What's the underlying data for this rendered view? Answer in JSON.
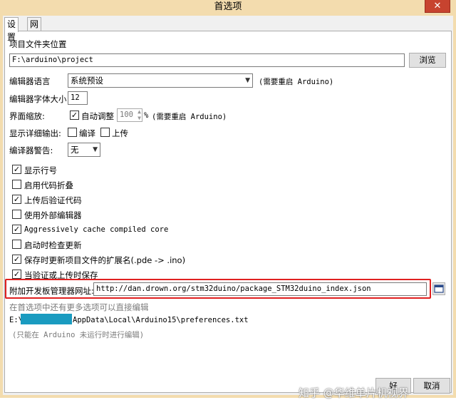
{
  "window": {
    "title": "首选项",
    "close": "✕"
  },
  "tabs": [
    "设置",
    "网络"
  ],
  "sketchbook": {
    "label": "项目文件夹位置",
    "path": "F:\\arduino\\project",
    "browse": "浏览"
  },
  "editor_language": {
    "label": "编辑器语言",
    "value": "系统预设",
    "note": "(需要重启 Arduino)"
  },
  "font_size": {
    "label": "编辑器字体大小",
    "value": "12"
  },
  "scaling": {
    "label": "界面缩放:",
    "auto_label": "自动调整",
    "auto_checked": true,
    "percent_value": "100",
    "percent_sign": "%",
    "note": "(需要重启 Arduino)"
  },
  "verbose": {
    "label": "显示详细输出:",
    "compile_label": "编译",
    "compile_checked": false,
    "upload_label": "上传",
    "upload_checked": false
  },
  "warnings": {
    "label": "编译器警告:",
    "value": "无"
  },
  "options": [
    {
      "label": "显示行号",
      "checked": true
    },
    {
      "label": "启用代码折叠",
      "checked": false
    },
    {
      "label": "上传后验证代码",
      "checked": true
    },
    {
      "label": "使用外部编辑器",
      "checked": false
    },
    {
      "label": "Aggressively cache compiled core",
      "checked": true
    },
    {
      "label": "启动时检查更新",
      "checked": false
    },
    {
      "label": "保存时更新项目文件的扩展名(.pde -> .ino)",
      "checked": true
    },
    {
      "label": "当验证或上传时保存",
      "checked": true
    }
  ],
  "boards_url": {
    "label": "附加开发板管理器网址:",
    "value": "http://dan.drown.org/stm32duino/package_STM32duino_index.json"
  },
  "footer": {
    "more_prefs": "在首选项中还有更多选项可以直接编辑",
    "prefs_path_prefix": "E:\\",
    "prefs_path_suffix": "AppData\\Local\\Arduino15\\preferences.txt",
    "edit_note": "(只能在 Arduino 未运行时进行编辑)"
  },
  "buttons": {
    "ok": "好",
    "cancel": "取消"
  },
  "watermark": "知乎 @华维单片机视界",
  "colors": {
    "highlight": "#e02020",
    "redacted": "#1a9bc0"
  },
  "icons": {
    "close": "close-icon",
    "dropdown": "chevron-down-icon",
    "url_edit": "window-edit-icon"
  }
}
